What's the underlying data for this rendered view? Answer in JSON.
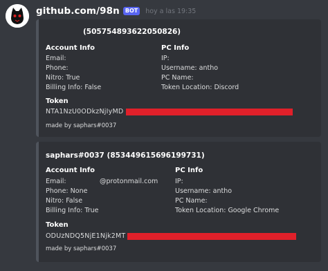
{
  "author": {
    "name": "github.com/98n",
    "tag": "BOT",
    "timestamp": "hoy a las 19:35"
  },
  "embeds": [
    {
      "title": "(505754893622050826)",
      "account": {
        "heading": "Account Info",
        "email": "Email:",
        "phone": "Phone:",
        "nitro": "Nitro: True",
        "billing": "Billing Info: False"
      },
      "pc": {
        "heading": "PC Info",
        "ip": "IP:",
        "username": "Username: antho",
        "pc_name": "PC Name:",
        "token_location": "Token Location: Discord"
      },
      "token": {
        "heading": "Token",
        "value": "NTA1NzU0ODkzNjIyMD"
      },
      "footer": "made by saphars#0037"
    },
    {
      "title": "saphars#0037 (853449615696199731)",
      "account": {
        "heading": "Account Info",
        "email": "Email:",
        "email_domain": "@protonmail.com",
        "phone": "Phone: None",
        "nitro": "Nitro: False",
        "billing": "Billing Info: True"
      },
      "pc": {
        "heading": "PC Info",
        "ip": "IP:",
        "username": "Username: antho",
        "pc_name": "PC Name:",
        "token_location": "Token Location: Google Chrome"
      },
      "token": {
        "heading": "Token",
        "value": "ODUzNDQ5NjE1Njk2MT"
      },
      "footer": "made by saphars#0037"
    }
  ],
  "colors": {
    "background": "#36393f",
    "embed_bg": "#2f3136",
    "embed_border": "#4f545c",
    "bot_tag": "#5865f2",
    "redaction": "#e0202a"
  }
}
